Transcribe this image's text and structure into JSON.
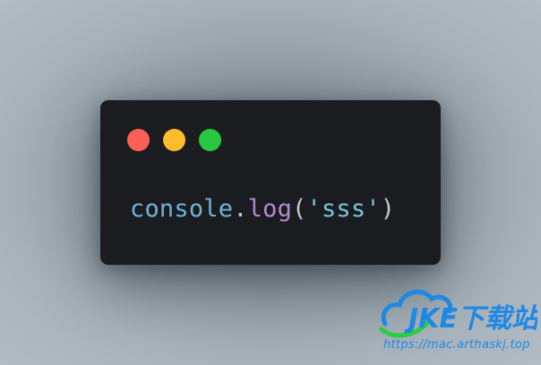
{
  "window": {
    "buttons": {
      "close_color": "#ff5f57",
      "minimize_color": "#febc2e",
      "maximize_color": "#28c840"
    },
    "code": {
      "object": "console",
      "dot": ".",
      "method": "log",
      "open_paren": "(",
      "string": "'sss'",
      "close_paren": ")"
    }
  },
  "watermark": {
    "logo_text": "JKE下载站",
    "url": "https://mac.arthaskj.top",
    "colors": {
      "blue": "#1e88e5",
      "green": "#2ecc40"
    }
  }
}
